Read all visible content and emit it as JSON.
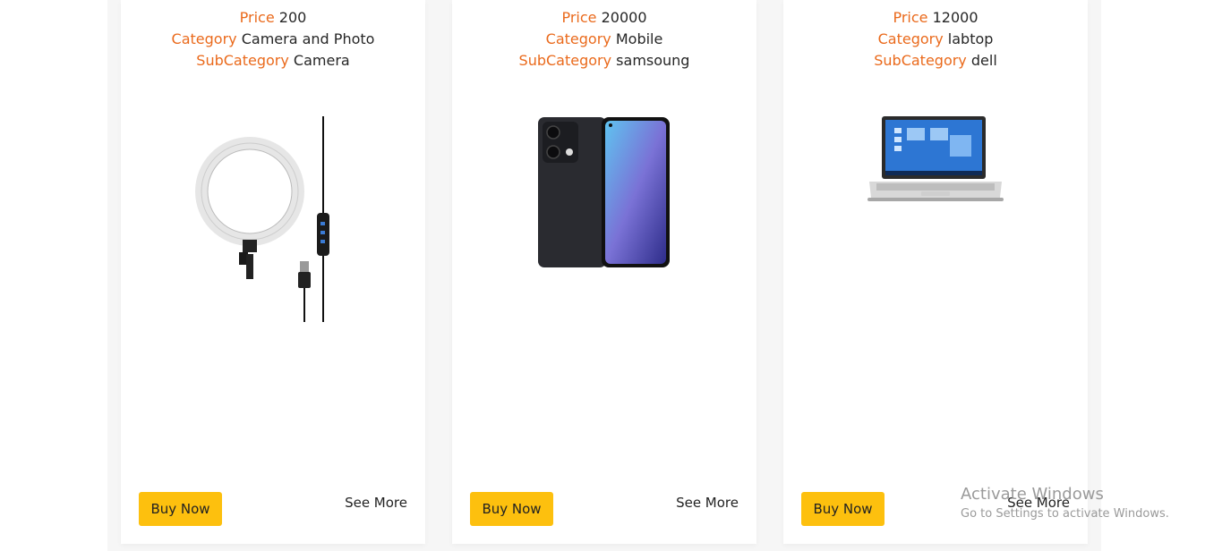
{
  "cards": [
    {
      "price_label": "Price",
      "price": "200",
      "category_label": "Category",
      "category": "Camera and Photo",
      "subcategory_label": "SubCategory",
      "subcategory": "Camera",
      "image": "ring-light-image",
      "buy_label": "Buy Now",
      "more_label": "See More"
    },
    {
      "price_label": "Price",
      "price": "20000",
      "category_label": "Category",
      "category": "Mobile",
      "subcategory_label": "SubCategory",
      "subcategory": "samsoung",
      "image": "smartphone-image",
      "buy_label": "Buy Now",
      "more_label": "See More"
    },
    {
      "price_label": "Price",
      "price": "12000",
      "category_label": "Category",
      "category": "labtop",
      "subcategory_label": "SubCategory",
      "subcategory": "dell",
      "image": "laptop-image",
      "buy_label": "Buy Now",
      "more_label": "See More"
    }
  ],
  "windows_watermark": {
    "title": "Activate Windows",
    "subtitle": "Go to Settings to activate Windows."
  },
  "colors": {
    "label": "#ea6a1c",
    "button": "#fdc00e",
    "panel": "#f6f6f6"
  }
}
